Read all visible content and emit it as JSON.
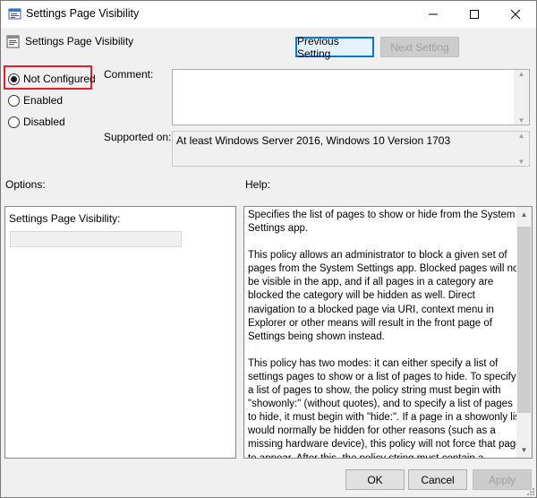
{
  "window": {
    "title": "Settings Page Visibility",
    "controls": {
      "minimize": "—",
      "maximize": "☐",
      "close": "✕"
    }
  },
  "header": {
    "policy_title": "Settings Page Visibility",
    "previous_label": "Previous Setting",
    "next_label": "Next Setting"
  },
  "state": {
    "options": [
      {
        "label": "Not Configured",
        "checked": true
      },
      {
        "label": "Enabled",
        "checked": false
      },
      {
        "label": "Disabled",
        "checked": false
      }
    ]
  },
  "comment": {
    "label": "Comment:",
    "value": ""
  },
  "supported": {
    "label": "Supported on:",
    "value": "At least Windows Server 2016, Windows 10 Version 1703"
  },
  "options_section": {
    "label": "Options:",
    "field_label": "Settings Page Visibility:",
    "field_value": ""
  },
  "help_section": {
    "label": "Help:",
    "paragraphs": [
      "Specifies the list of pages to show or hide from the System Settings app.",
      "This policy allows an administrator to block a given set of pages from the System Settings app. Blocked pages will not be visible in the app, and if all pages in a category are blocked the category will be hidden as well. Direct navigation to a blocked page via URI, context menu in Explorer or other means will result in the front page of Settings being shown instead.",
      "This policy has two modes: it can either specify a list of settings pages to show or a list of pages to hide. To specify a list of pages to show, the policy string must begin with \"showonly:\" (without quotes), and to specify a list of pages to hide, it must begin with \"hide:\". If a page in a showonly list would normally be hidden for other reasons (such as a missing hardware device), this policy will not force that page to appear. After this, the policy string must contain a semicolon-delimited list of settings page identifiers. The identifier for any given settings page is the published URI for that page, minus the \"ms-settings:\" protocol part."
    ]
  },
  "footer": {
    "ok_label": "OK",
    "cancel_label": "Cancel",
    "apply_label": "Apply"
  },
  "colors": {
    "focus": "#0078d7",
    "highlight": "#e0212b",
    "disabled_text": "#a0a0a0"
  }
}
